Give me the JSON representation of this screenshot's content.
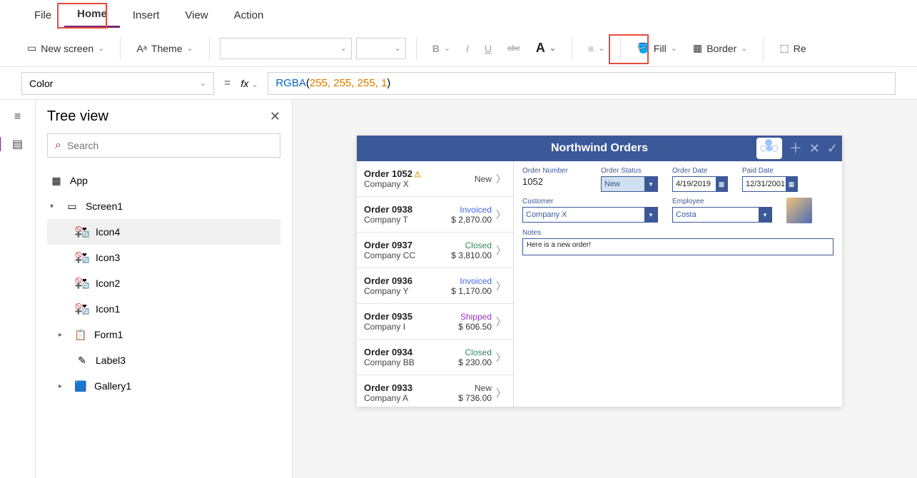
{
  "menu": {
    "file": "File",
    "home": "Home",
    "insert": "Insert",
    "view": "View",
    "action": "Action"
  },
  "ribbon": {
    "new_screen": "New screen",
    "theme": "Theme",
    "bold": "B",
    "italic": "I",
    "underline": "U",
    "strike": "abc",
    "fontcolor": "A",
    "fill": "Fill",
    "border": "Border",
    "reorder": "Re"
  },
  "formula": {
    "property": "Color",
    "eq": "=",
    "fx": "fx",
    "fn": "RGBA",
    "args": "255,  255,  255,  1"
  },
  "tree": {
    "title": "Tree view",
    "search_placeholder": "Search",
    "app": "App",
    "screen1": "Screen1",
    "icon4": "Icon4",
    "icon3": "Icon3",
    "icon2": "Icon2",
    "icon1": "Icon1",
    "form1": "Form1",
    "label3": "Label3",
    "gallery1": "Gallery1"
  },
  "app": {
    "title": "Northwind Orders",
    "orders": [
      {
        "num": "Order 1052",
        "co": "Company X",
        "status": "New",
        "scl": "s-new",
        "price": "",
        "warn": true
      },
      {
        "num": "Order 0938",
        "co": "Company T",
        "status": "Invoiced",
        "scl": "s-inv",
        "price": "$ 2,870.00"
      },
      {
        "num": "Order 0937",
        "co": "Company CC",
        "status": "Closed",
        "scl": "s-closed",
        "price": "$ 3,810.00"
      },
      {
        "num": "Order 0936",
        "co": "Company Y",
        "status": "Invoiced",
        "scl": "s-inv",
        "price": "$ 1,170.00"
      },
      {
        "num": "Order 0935",
        "co": "Company I",
        "status": "Shipped",
        "scl": "s-ship",
        "price": "$ 606.50"
      },
      {
        "num": "Order 0934",
        "co": "Company BB",
        "status": "Closed",
        "scl": "s-closed",
        "price": "$ 230.00"
      },
      {
        "num": "Order 0933",
        "co": "Company A",
        "status": "New",
        "scl": "s-new",
        "price": "$ 736.00"
      }
    ],
    "detail": {
      "order_number_label": "Order Number",
      "order_number": "1052",
      "order_status_label": "Order Status",
      "order_status": "New",
      "order_date_label": "Order Date",
      "order_date": "4/19/2019",
      "paid_date_label": "Paid Date",
      "paid_date": "12/31/2001",
      "customer_label": "Customer",
      "customer": "Company X",
      "employee_label": "Employee",
      "employee": "Costa",
      "notes_label": "Notes",
      "notes": "Here is a new order!"
    }
  }
}
